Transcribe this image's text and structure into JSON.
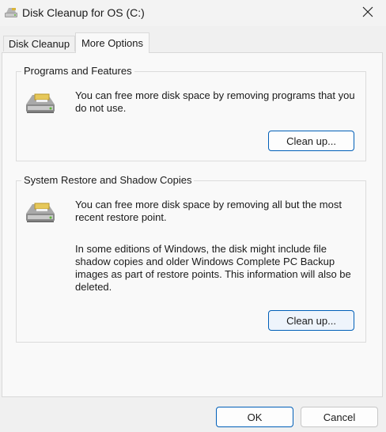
{
  "window": {
    "title": "Disk Cleanup for OS (C:)",
    "close_icon": "close-icon"
  },
  "tabs": [
    {
      "label": "Disk Cleanup",
      "selected": false
    },
    {
      "label": "More Options",
      "selected": true
    }
  ],
  "programs_group": {
    "title": "Programs and Features",
    "description": "You can free more disk space by removing programs that you do not use.",
    "button_label": "Clean up...",
    "icon": "disk-drive-icon"
  },
  "restore_group": {
    "title": "System Restore and Shadow Copies",
    "description": "You can free more disk space by removing all but the most recent restore point.",
    "description2": "In some editions of Windows, the disk might include file shadow copies and older Windows Complete PC Backup images as part of restore points. This information will also be deleted.",
    "button_label": "Clean up...",
    "icon": "disk-drive-icon"
  },
  "footer": {
    "ok_label": "OK",
    "cancel_label": "Cancel"
  },
  "colors": {
    "accent": "#005fb8",
    "background": "#f0f0f0",
    "panel": "#f9f9f9"
  }
}
